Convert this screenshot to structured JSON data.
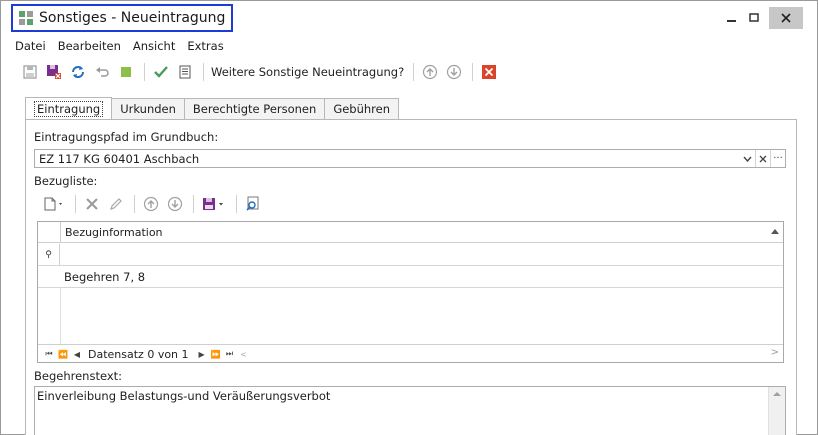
{
  "window": {
    "title": "Sonstiges - Neueintragung",
    "controls": {
      "minimize": "—",
      "maximize": "▭",
      "close": "✕"
    }
  },
  "menu": [
    "Datei",
    "Bearbeiten",
    "Ansicht",
    "Extras"
  ],
  "toolbar": {
    "question_label": "Weitere Sonstige Neueintragung?",
    "icons": [
      "save-icon",
      "save-close-icon",
      "refresh-icon",
      "undo-icon",
      "stop-icon",
      "check-icon",
      "list-icon",
      "arrow-up-icon",
      "arrow-down-icon",
      "cancel-icon"
    ]
  },
  "tabs": [
    {
      "label": "Eintragung",
      "active": true
    },
    {
      "label": "Urkunden",
      "active": false
    },
    {
      "label": "Berechtigte Personen",
      "active": false
    },
    {
      "label": "Gebühren",
      "active": false
    }
  ],
  "form": {
    "path_label": "Eintragungspfad im Grundbuch:",
    "path_value": "EZ 117 KG 60401 Aschbach",
    "combo_buttons": {
      "dropdown": "⌵",
      "clear": "✕",
      "more": "···"
    },
    "bezugliste_label": "Bezugliste:",
    "grid": {
      "column": "Bezuginformation",
      "filter_row_icon": "⚲",
      "rows": [
        "Begehren 7, 8"
      ],
      "footer": {
        "record_text": "Datensatz 0 von 1",
        "nav": {
          "first": "⏮",
          "prev_page": "⏪",
          "prev": "◀",
          "next": "▶",
          "next_page": "⏩",
          "last": "⏭",
          "scroll_left": "<",
          "scroll_right": ">"
        }
      }
    },
    "begehrenstext_label": "Begehrenstext:",
    "begehrenstext_value": "Einverleibung Belastungs-und Veräußerungsverbot"
  },
  "colors": {
    "title_highlight": "#1f3bd6",
    "save_purple": "#7a2e8e",
    "refresh_blue": "#1f6fc4",
    "stop_green": "#8dc04a",
    "check_green": "#4a9a5a",
    "cancel_red": "#d9452a"
  }
}
